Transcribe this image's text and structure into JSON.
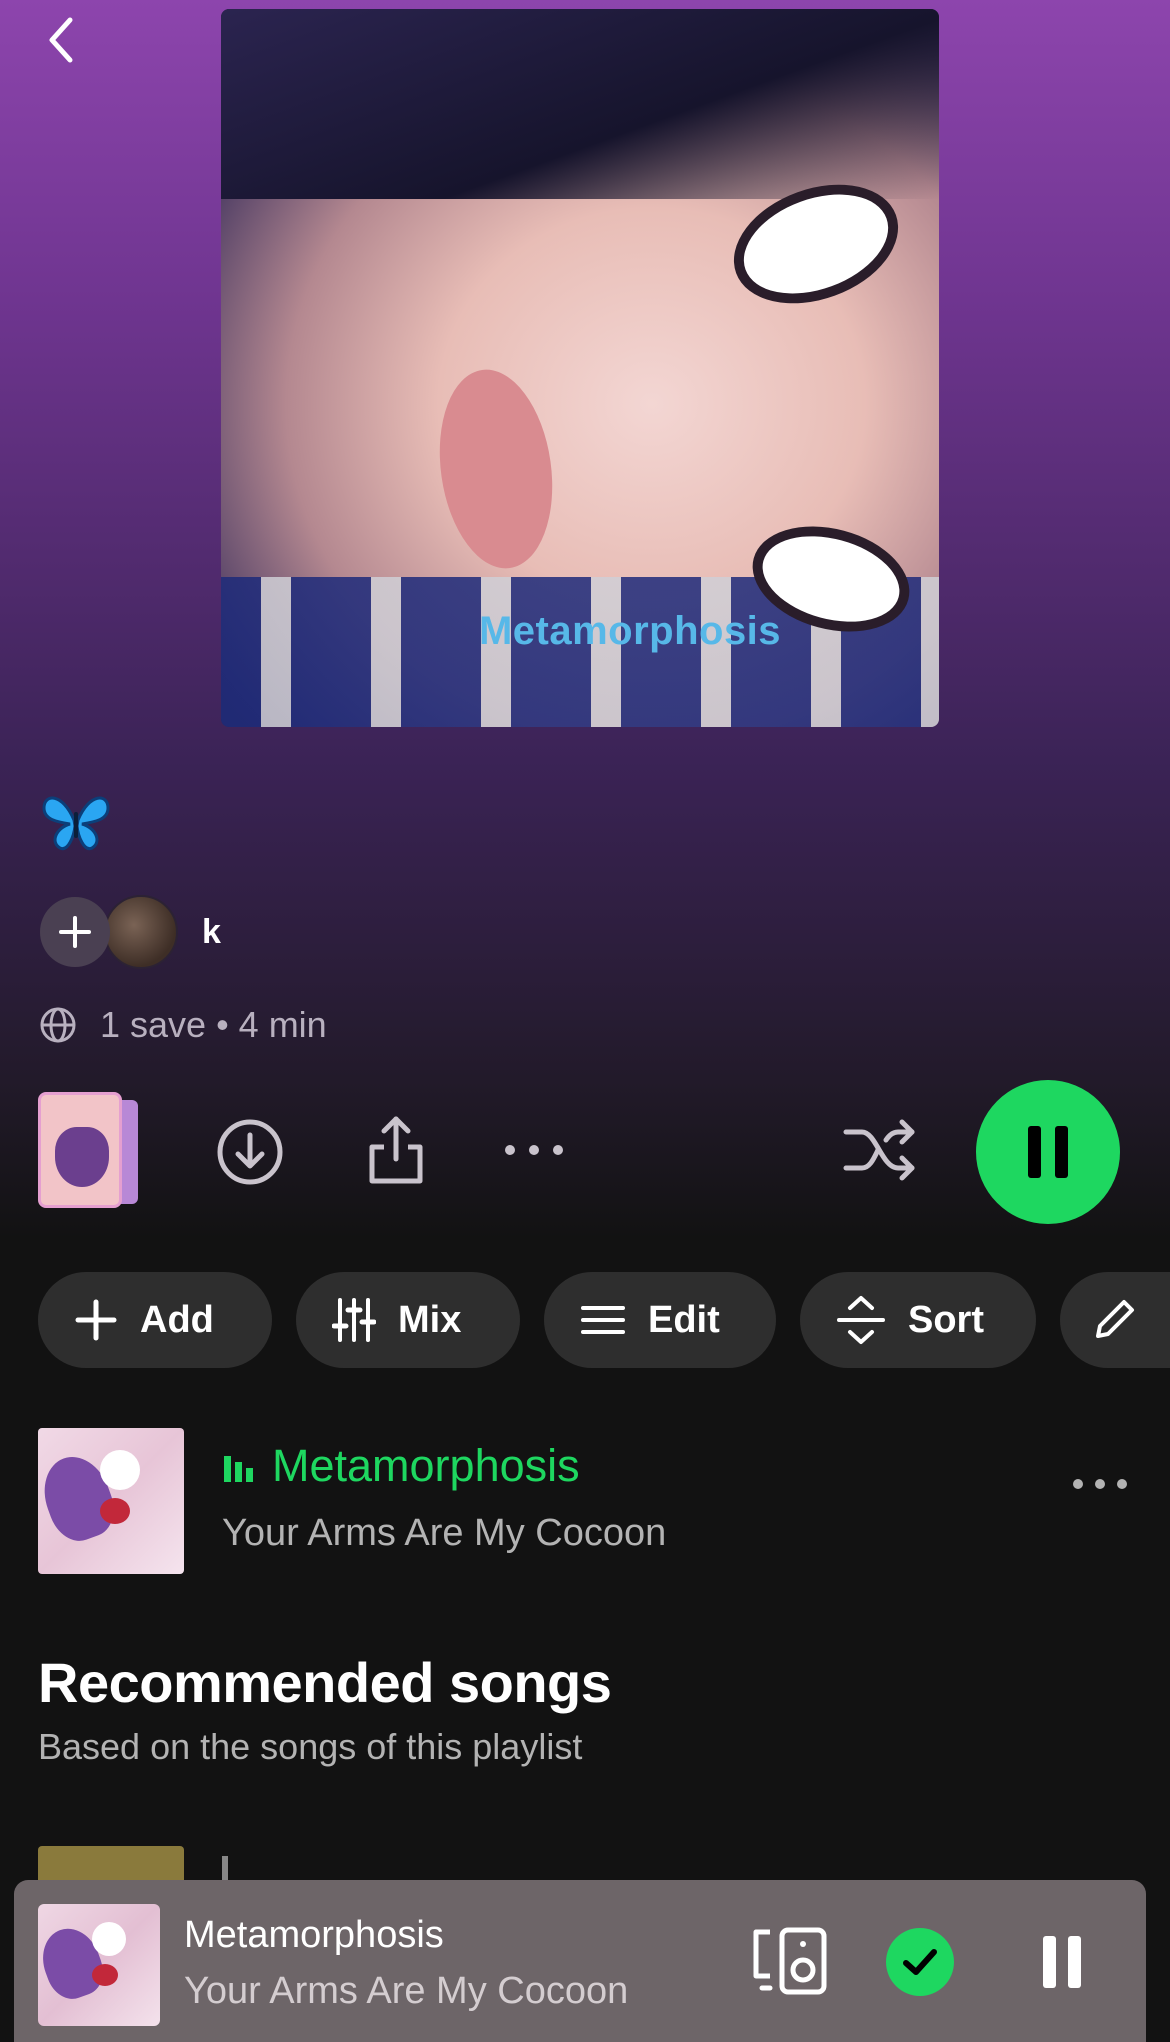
{
  "header": {
    "back_icon": "chevron-left-icon"
  },
  "cover": {
    "overlay_text": "Metamorphosis"
  },
  "playlist": {
    "title_emoji": "butterfly-emoji",
    "owner_name": "k",
    "meta": "1 save • 4 min"
  },
  "actions": {
    "icons": [
      "download-icon",
      "share-icon",
      "more-horizontal-icon",
      "shuffle-icon",
      "pause-icon"
    ],
    "accent_color": "#1ed760"
  },
  "chips": {
    "add": "Add",
    "mix": "Mix",
    "edit": "Edit",
    "sort": "Sort"
  },
  "tracks": [
    {
      "title": "Metamorphosis",
      "artist": "Your Arms Are My Cocoon",
      "now_playing": true
    }
  ],
  "recommended": {
    "title": "Recommended songs",
    "subtitle": "Based on the songs of this playlist"
  },
  "now_playing_bar": {
    "title": "Metamorphosis",
    "artist": "Your Arms Are My Cocoon",
    "background": "#6d6568"
  }
}
